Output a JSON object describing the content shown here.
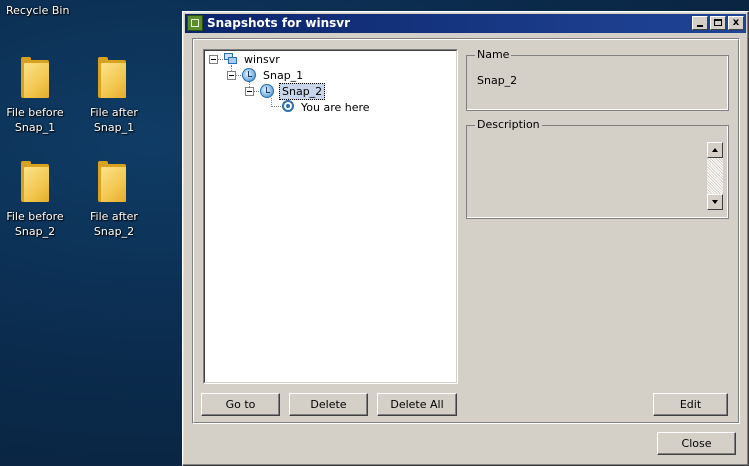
{
  "desktop": {
    "recycle_bin": "Recycle Bin",
    "icons": [
      {
        "line1": "File before",
        "line2": "Snap_1"
      },
      {
        "line1": "File after",
        "line2": "Snap_1"
      },
      {
        "line1": "File before",
        "line2": "Snap_2"
      },
      {
        "line1": "File after",
        "line2": "Snap_2"
      }
    ]
  },
  "window": {
    "title": "Snapshots for winsvr",
    "close_glyph": "x"
  },
  "tree": {
    "root": "winsvr",
    "snap1": "Snap_1",
    "snap2": "Snap_2",
    "here": "You are here"
  },
  "details": {
    "name_label": "Name",
    "name_value": "Snap_2",
    "description_label": "Description",
    "description_value": ""
  },
  "buttons": {
    "goto": "Go to",
    "delete": "Delete",
    "delete_all": "Delete All",
    "edit": "Edit",
    "close": "Close"
  }
}
